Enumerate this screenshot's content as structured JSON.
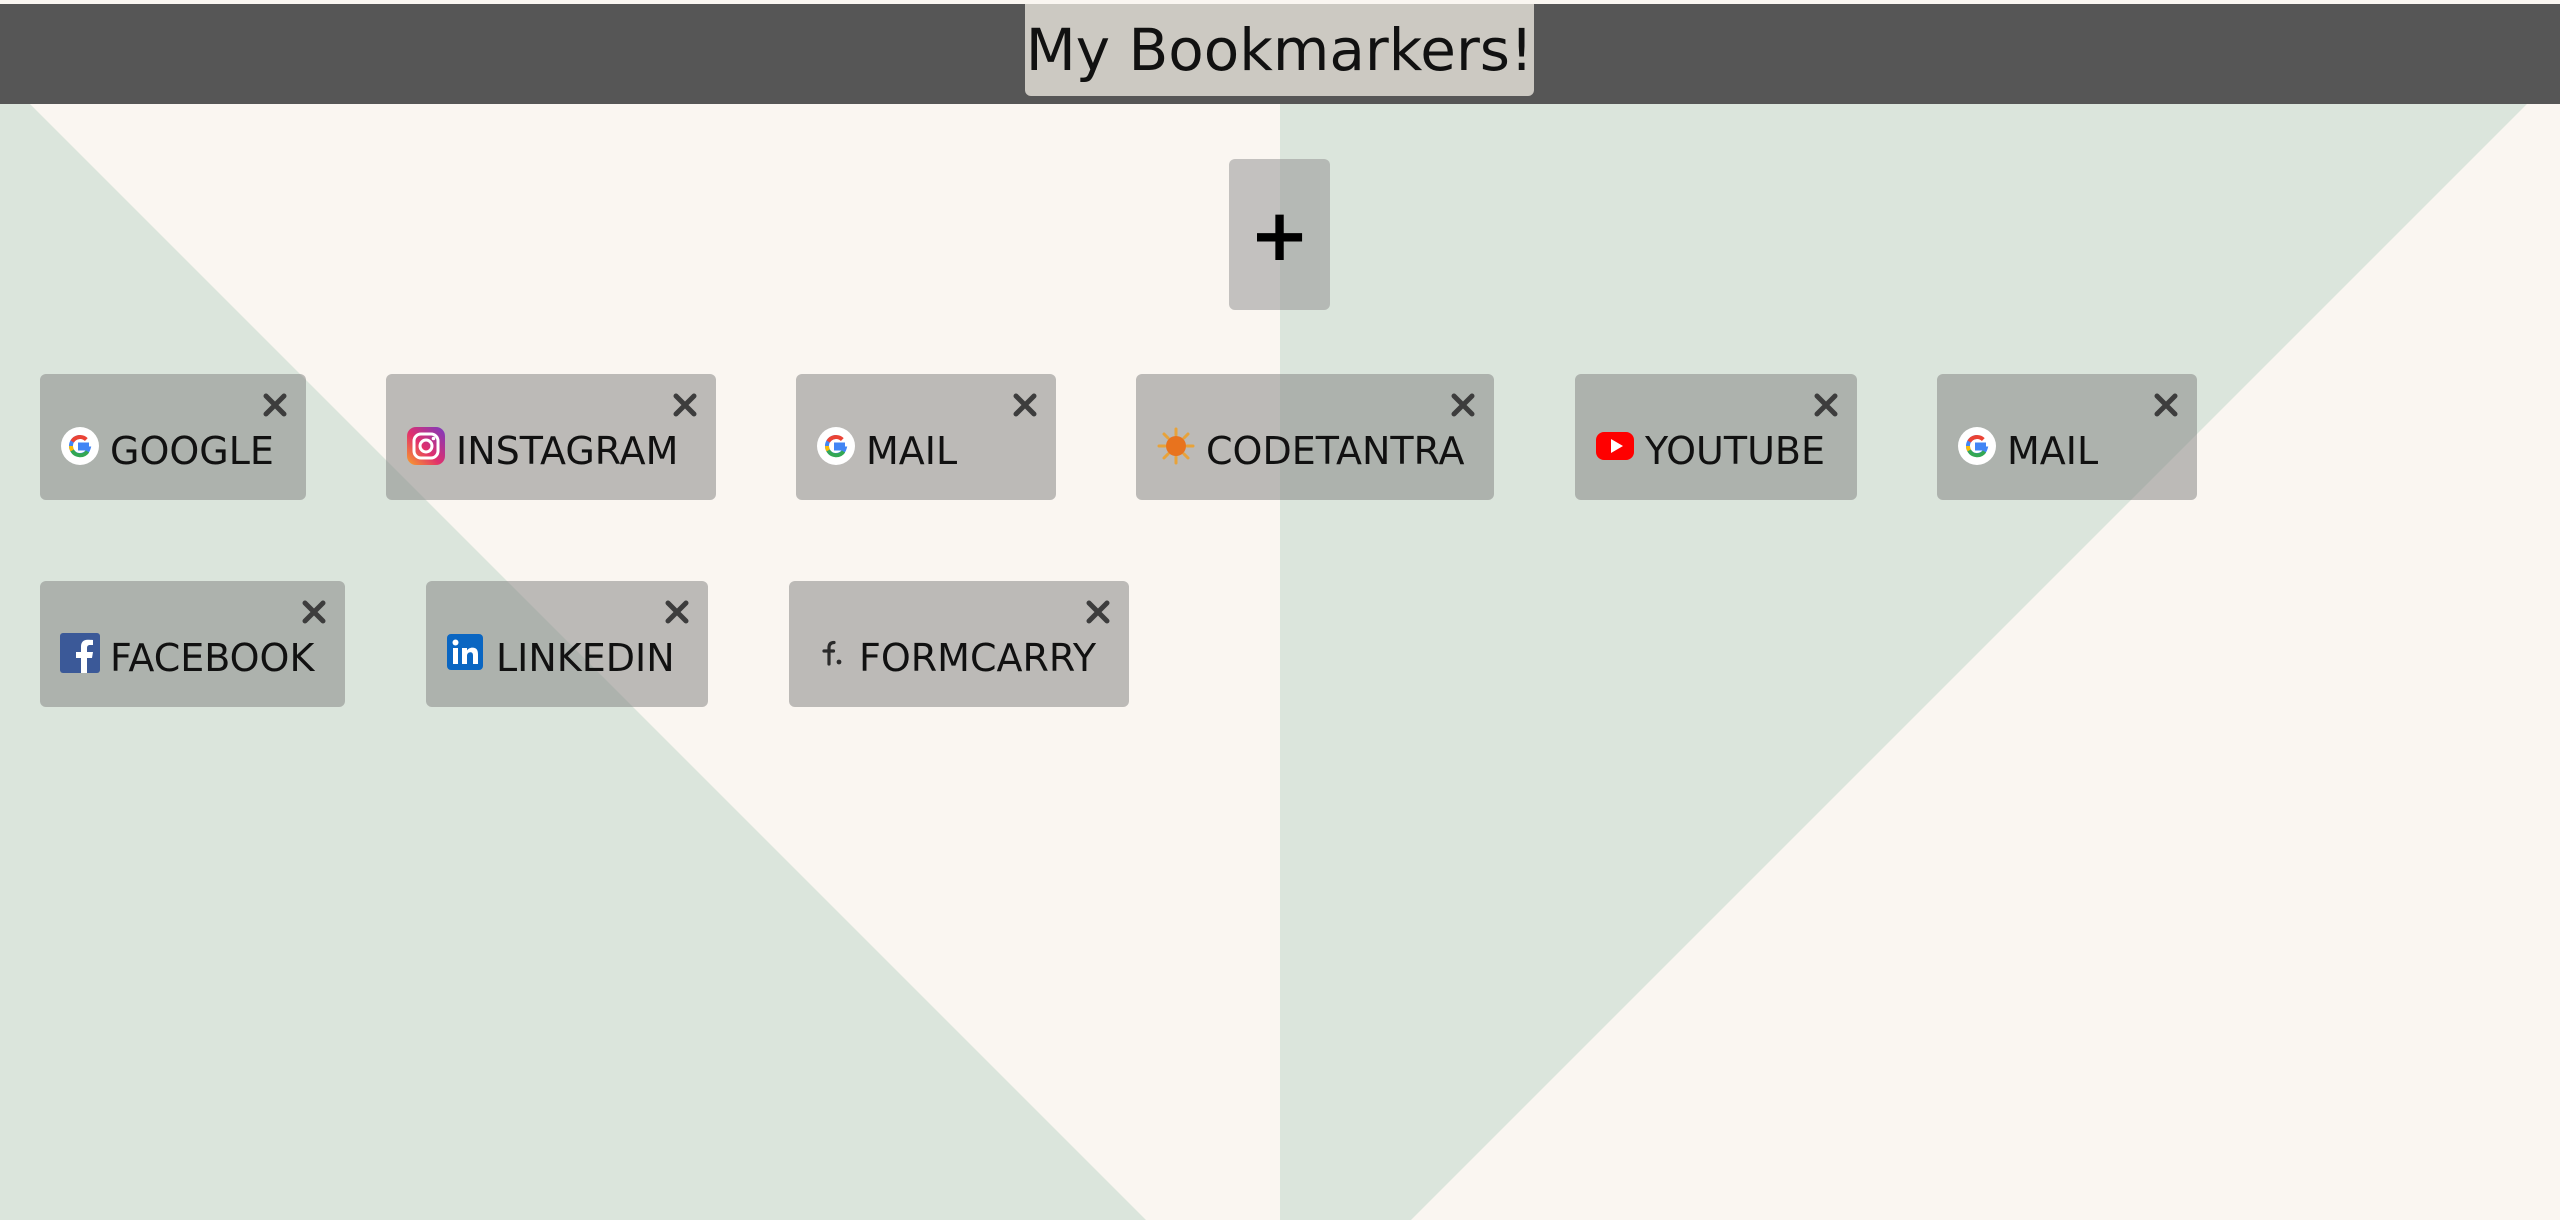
{
  "header": {
    "title": "My Bookmarkers!"
  },
  "add_button": {
    "label": "+"
  },
  "bookmarks": [
    {
      "label": "GOOGLE",
      "icon": "google-icon"
    },
    {
      "label": "INSTAGRAM",
      "icon": "instagram-icon"
    },
    {
      "label": "MAIL",
      "icon": "google-icon"
    },
    {
      "label": "CODETANTRA",
      "icon": "codetantra-icon"
    },
    {
      "label": "YOUTUBE",
      "icon": "youtube-icon"
    },
    {
      "label": "MAIL",
      "icon": "google-icon"
    },
    {
      "label": "FACEBOOK",
      "icon": "facebook-icon"
    },
    {
      "label": "LINKEDIN",
      "icon": "linkedin-icon"
    },
    {
      "label": "FORMCARRY",
      "icon": "formcarry-icon"
    }
  ],
  "colors": {
    "header": "#565656",
    "title_box": "#ccc9c2",
    "background_light": "#faf6f1",
    "background_green": "#dbe5dc",
    "card": "#a8a6a2"
  }
}
